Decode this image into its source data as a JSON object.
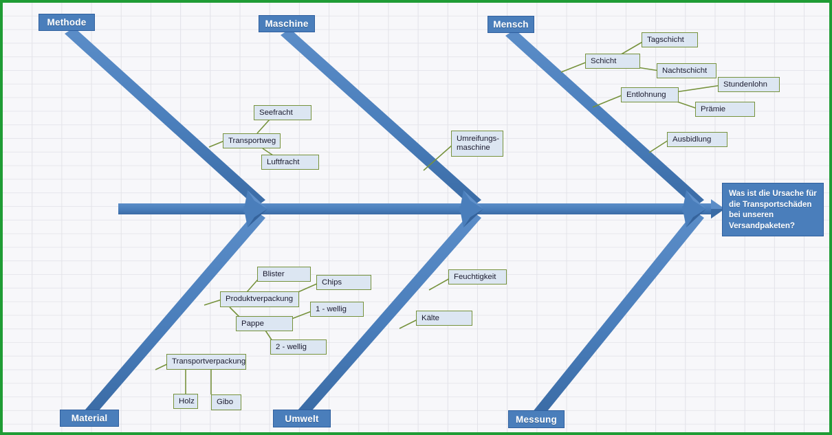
{
  "diagram": {
    "type": "ishikawa-fishbone",
    "border_color": "#1f9c35",
    "bone_color": "#4a7ebb",
    "bone_shade_color": "#3a6ba5",
    "cause_box_fill": "#dce6f2",
    "cause_box_border": "#76923c",
    "connector_color": "#76923c",
    "header_fill": "#4a7ebb",
    "header_border": "#2f5f9e"
  },
  "problem": {
    "text": "Was ist  die Ursache für\ndie Transportschäden\nbei unseren\nVersandpaketen?"
  },
  "categories": [
    {
      "id": "methode",
      "label": "Methode",
      "position": "top-left"
    },
    {
      "id": "maschine",
      "label": "Maschine",
      "position": "top-middle"
    },
    {
      "id": "mensch",
      "label": "Mensch",
      "position": "top-right"
    },
    {
      "id": "material",
      "label": "Material",
      "position": "bottom-left"
    },
    {
      "id": "umwelt",
      "label": "Umwelt",
      "position": "bottom-middle"
    },
    {
      "id": "messung",
      "label": "Messung",
      "position": "bottom-right"
    }
  ],
  "causes": {
    "methode": [
      {
        "id": "transportweg",
        "label": "Transportweg",
        "level": 1
      },
      {
        "id": "seefracht",
        "label": "Seefracht",
        "level": 2
      },
      {
        "id": "luftfracht",
        "label": "Luftfracht",
        "level": 2
      }
    ],
    "maschine": [
      {
        "id": "umreifungsmaschine",
        "label": "Umreifungs-\nmaschine",
        "level": 1
      }
    ],
    "mensch": [
      {
        "id": "schicht",
        "label": "Schicht",
        "level": 1
      },
      {
        "id": "tagschicht",
        "label": "Tagschicht",
        "level": 2
      },
      {
        "id": "nachtschicht",
        "label": "Nachtschicht",
        "level": 2
      },
      {
        "id": "entlohnung",
        "label": "Entlohnung",
        "level": 1
      },
      {
        "id": "stundenlohn",
        "label": "Stundenlohn",
        "level": 2
      },
      {
        "id": "praemie",
        "label": "Prämie",
        "level": 2
      },
      {
        "id": "ausbidlung",
        "label": "Ausbidlung",
        "level": 1
      }
    ],
    "material": [
      {
        "id": "produktverpackung",
        "label": "Produktverpackung",
        "level": 1
      },
      {
        "id": "blister",
        "label": "Blister",
        "level": 2
      },
      {
        "id": "chips",
        "label": "Chips",
        "level": 2
      },
      {
        "id": "pappe",
        "label": "Pappe",
        "level": 2
      },
      {
        "id": "wellig1",
        "label": "1 - wellig",
        "level": 3
      },
      {
        "id": "wellig2",
        "label": "2 - wellig",
        "level": 3
      },
      {
        "id": "transportverpackung",
        "label": "Transportverpackung",
        "level": 1
      },
      {
        "id": "holz",
        "label": "Holz",
        "level": 2
      },
      {
        "id": "gibo",
        "label": "Gibo",
        "level": 2
      }
    ],
    "umwelt": [
      {
        "id": "feuchtigkeit",
        "label": "Feuchtigkeit",
        "level": 1
      },
      {
        "id": "kaelte",
        "label": "Kälte",
        "level": 1
      }
    ],
    "messung": []
  }
}
